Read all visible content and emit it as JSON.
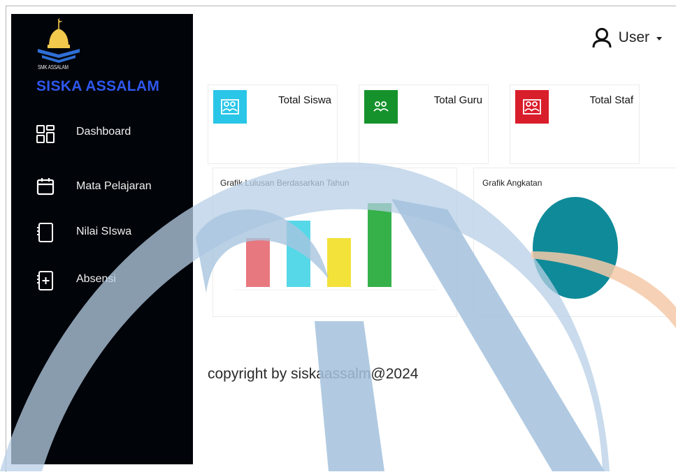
{
  "sidebar": {
    "logo_caption": "SMK ASSALAM",
    "brand": "SISKA ASSALAM",
    "items": [
      {
        "label": "Dashboard",
        "icon": "dashboard-icon"
      },
      {
        "label": "Mata Pelajaran",
        "icon": "calendar-icon"
      },
      {
        "label": "Nilai SIswa",
        "icon": "notebook-icon"
      },
      {
        "label": "Absensi",
        "icon": "notebook-plus-icon"
      }
    ]
  },
  "header": {
    "user_label": "User"
  },
  "cards": [
    {
      "title": "Total Siswa",
      "color": "#29c6e8",
      "icon": "users-icon"
    },
    {
      "title": "Total Guru",
      "color": "#16922c",
      "icon": "users-icon"
    },
    {
      "title": "Total Staf",
      "color": "#d91e2b",
      "icon": "users-icon"
    }
  ],
  "chart_data": [
    {
      "type": "bar",
      "title": "Grafik Lulusan Berdasarkan Tahun",
      "categories": [
        "",
        "",
        "",
        ""
      ],
      "values": [
        70,
        95,
        70,
        120
      ],
      "colors": [
        "#e8787f",
        "#56d8e8",
        "#f2e23a",
        "#36b14a"
      ],
      "ylim": [
        0,
        130
      ],
      "grid": false,
      "legend": "none"
    },
    {
      "type": "pie",
      "title": "Grafik Angkatan",
      "labels": [
        ""
      ],
      "values": [
        100
      ],
      "colors": [
        "#0f8a99"
      ],
      "legend": "none"
    }
  ],
  "footer": {
    "text": "copyright by siskaassalm@2024"
  }
}
